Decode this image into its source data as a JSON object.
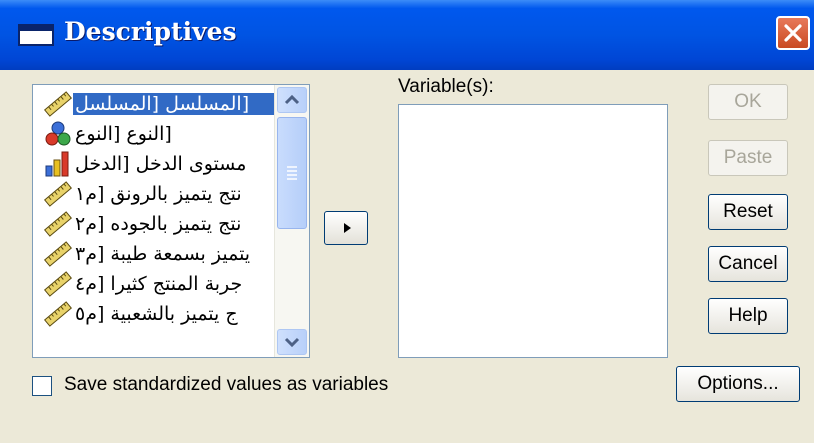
{
  "window": {
    "title": "Descriptives"
  },
  "source_list": {
    "items": [
      {
        "label": "[المسلسل [المسلسل",
        "icon": "ruler-icon",
        "selected": true
      },
      {
        "label": "[النوع [النوع",
        "icon": "nominal-balls-icon",
        "selected": false
      },
      {
        "label": "مستوى الدخل [الدخل",
        "icon": "ordinal-bars-icon",
        "selected": false
      },
      {
        "label": "نتج يتميز بالرونق [م١",
        "icon": "ruler-icon",
        "selected": false
      },
      {
        "label": "نتج يتميز بالجوده [م٢",
        "icon": "ruler-icon",
        "selected": false
      },
      {
        "label": "يتميز بسمعة طيبة [م٣",
        "icon": "ruler-icon",
        "selected": false
      },
      {
        "label": "جربة المنتج كثيرا [م٤",
        "icon": "ruler-icon",
        "selected": false
      },
      {
        "label": "ج يتميز بالشعبية [م٥",
        "icon": "ruler-icon",
        "selected": false
      }
    ]
  },
  "move_button": {
    "icon": "right-arrow-icon"
  },
  "target": {
    "label": "Variable(s):"
  },
  "buttons": {
    "ok": "OK",
    "paste": "Paste",
    "reset": "Reset",
    "cancel": "Cancel",
    "help": "Help",
    "options": "Options..."
  },
  "checkbox": {
    "label": "Save standardized values as variables",
    "checked": false
  },
  "colors": {
    "titlebar": "#0054e3",
    "selection": "#316ac5",
    "face": "#ece9d8"
  }
}
